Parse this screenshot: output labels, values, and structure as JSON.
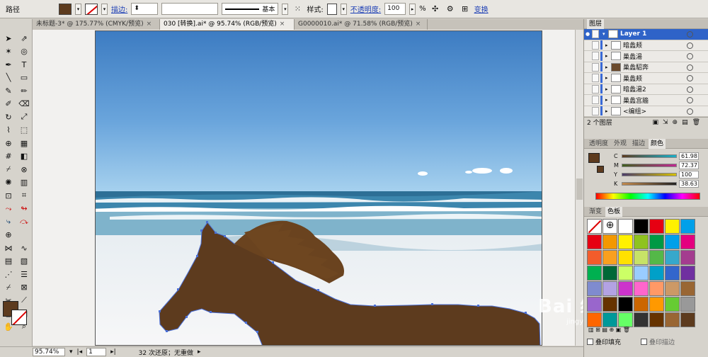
{
  "control_bar": {
    "path_label": "路径",
    "stroke_label": "描边:",
    "stroke_profile": "基本",
    "style_label": "样式:",
    "opacity_label": "不透明度:",
    "opacity_value": "100",
    "opacity_unit": "%",
    "transform_label": "变换",
    "fill_color": "#5d3b1e"
  },
  "tabs": [
    {
      "label": "未标题-3* @ 175.77% (CMYK/预览)",
      "close": "×",
      "active": false
    },
    {
      "label": "030 [转换].ai* @ 95.74% (RGB/预览)",
      "close": "×",
      "active": true
    },
    {
      "label": "G0000010.ai* @ 71.58% (RGB/预览)",
      "close": "×",
      "active": false
    }
  ],
  "status": {
    "zoom": "95.74%",
    "page": "1",
    "undo_text": "32 次还原；无重做"
  },
  "layers_panel": {
    "title": "图层",
    "top_layer": "Layer 1",
    "items": [
      {
        "label": "暗蠡颊",
        "thumb": "light"
      },
      {
        "label": "巢蠡湯",
        "thumb": "light"
      },
      {
        "label": "巢蠡駋奔",
        "thumb": "dark"
      },
      {
        "label": "巢蠡颊",
        "thumb": "light"
      },
      {
        "label": "暗蠡湯2",
        "thumb": "light"
      },
      {
        "label": "巢蠡宫牆",
        "thumb": "light"
      },
      {
        "label": "<编组>",
        "thumb": "light"
      }
    ],
    "footer": "2 个图层"
  },
  "color_panel": {
    "tabs": [
      "透明度",
      "外观",
      "描边",
      "颜色"
    ],
    "active_tab": "颜色",
    "channels": [
      {
        "name": "C",
        "value": "61.98",
        "color": "#19b0c9"
      },
      {
        "name": "M",
        "value": "72.37",
        "color": "#c02890"
      },
      {
        "name": "Y",
        "value": "100",
        "color": "#d6c000"
      },
      {
        "name": "K",
        "value": "38.63",
        "color": "#444444"
      }
    ]
  },
  "swatches_panel": {
    "tabs": [
      "渐变",
      "色板"
    ],
    "active_tab": "色板",
    "colors": [
      "#ffffff",
      "#ffffff",
      "#ffffff",
      "#000000",
      "#e60012",
      "#fff100",
      "#00a0e9",
      "#e60012",
      "#f39800",
      "#fff100",
      "#8fc31f",
      "#009944",
      "#00a0e9",
      "#e4007f",
      "#f35c2b",
      "#f9a01f",
      "#ffe100",
      "#c7e267",
      "#54b848",
      "#36a8cb",
      "#a43c8f",
      "#00b050",
      "#006837",
      "#ccff66",
      "#99ccff",
      "#00a0c8",
      "#3366cc",
      "#7030a0",
      "#7f8bcf",
      "#b3a2e3",
      "#cc33cc",
      "#ff66cc",
      "#ff9966",
      "#cc9966",
      "#996633",
      "#9966cc",
      "#663300",
      "#000000",
      "#cc6600",
      "#ff9900",
      "#66cc33",
      "#999999",
      "#ff6600",
      "#009999",
      "#66ff66",
      "#333333",
      "#663300",
      "#996633",
      "#5d3b1e"
    ],
    "overprint_fill": "叠印填充",
    "overprint_stroke": "叠印描边"
  },
  "watermark": {
    "brand": "Bai 经验",
    "url": "jingyan.baidu.com"
  }
}
